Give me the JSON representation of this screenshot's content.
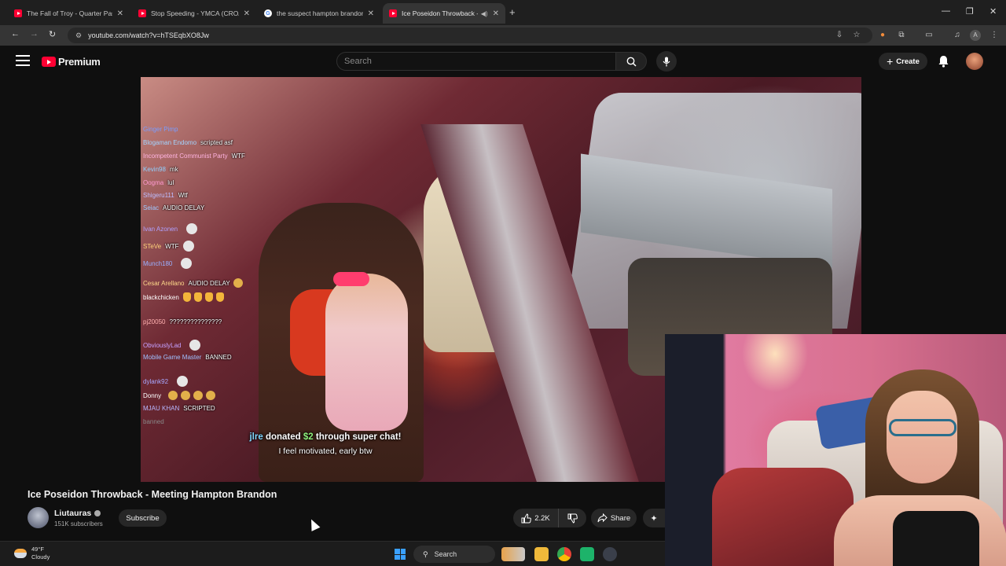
{
  "browser": {
    "tabs": [
      {
        "title": "The Fall of Troy - Quarter Past",
        "icon": "youtube-icon",
        "active": false
      },
      {
        "title": "Stop Speeding - YMCA (CROAC",
        "icon": "youtube-icon",
        "active": false
      },
      {
        "title": "the suspect hampton brandon",
        "icon": "google-icon",
        "active": false
      },
      {
        "title": "Ice Poseidon Throwback - N",
        "icon": "youtube-icon",
        "active": true
      }
    ],
    "url": "youtube.com/watch?v=hTSEqbXO8Jw",
    "new_tab": "+"
  },
  "masthead": {
    "brand": "Premium",
    "search_placeholder": "Search",
    "create_label": "Create"
  },
  "video": {
    "chat": [
      {
        "user": "Ginger Pimp",
        "message": "",
        "color": "#7a9cff"
      },
      {
        "user": "Blogaman Endomo",
        "message": "scripted asf",
        "color": "#a3d4ff"
      },
      {
        "user": "Incompetent Communist Party",
        "message": "WTF",
        "color": "#ffb3e0"
      },
      {
        "user": "Kevin98",
        "message": "mk",
        "color": "#8fd0ff"
      },
      {
        "user": "Oogma",
        "message": "lul",
        "color": "#ff9ad1"
      },
      {
        "user": "Shigeru111",
        "message": "Wtf",
        "color": "#bdbdff"
      },
      {
        "user": "Seiac",
        "message": "AUDIO DELAY",
        "color": "#9fc9ff"
      },
      {
        "user": "Ivan Azonen",
        "message": "",
        "color": "#b0a0ff"
      },
      {
        "user": "STeVe",
        "message": "WTF",
        "color": "#ffd27a"
      },
      {
        "user": "Munch180",
        "message": "",
        "color": "#9ab0ff"
      },
      {
        "user": "Cesar Arellano",
        "message": "AUDIO DELAY",
        "color": "#ffd98a"
      },
      {
        "user": "blackchicken",
        "message": "",
        "color": "#ffffff"
      },
      {
        "user": "pj20050",
        "message": "???????????????",
        "color": "#ffb0b0"
      },
      {
        "user": "ObviouslyLad",
        "message": "",
        "color": "#c5a0ff"
      },
      {
        "user": "Mobile Game Master",
        "message": "BANNED",
        "color": "#a0c0ff"
      },
      {
        "user": "dylank92",
        "message": "",
        "color": "#a8a8ff"
      },
      {
        "user": "Donny",
        "message": "",
        "color": "#ffffff"
      },
      {
        "user": "MJAU KHAN",
        "message": "SCRIPTED",
        "color": "#b8b8ff"
      },
      {
        "user": "banned",
        "message": "",
        "color": "#888888"
      }
    ],
    "superchat": {
      "user": "jlre",
      "before_amount": "donated",
      "amount": "$2",
      "after_amount": "through super chat!",
      "message": "I feel motivated, early btw"
    }
  },
  "details": {
    "title": "Ice Poseidon Throwback - Meeting Hampton Brandon",
    "channel_name": "Liutauras",
    "subscribers": "151K subscribers",
    "subscribe_label": "Subscribe",
    "likes": "2.2K",
    "share_label": "Share"
  },
  "taskbar": {
    "temperature": "49°F",
    "condition": "Cloudy",
    "search_label": "Search"
  }
}
